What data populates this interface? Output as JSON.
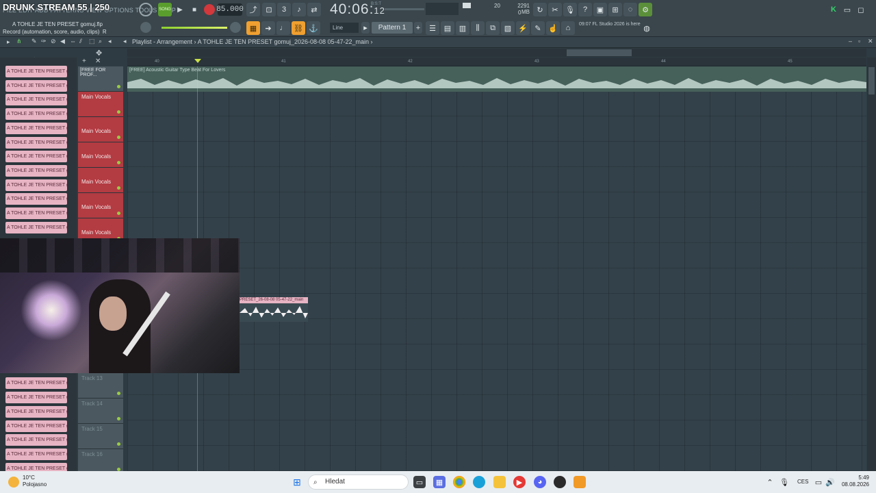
{
  "overlay": {
    "stream_title": "DRUNK STREAM 55 | 250",
    "menu_text": "FILE EDIT ADD PATTERNS VIEW OPTIONS TOOLS HELP"
  },
  "hint": {
    "file": "A TOHLE JE TEN PRESET gomuj.flp",
    "desc": "Record (automation, score, audio, clips)",
    "desc_suffix": "R"
  },
  "transport": {
    "song_label": "SONG",
    "tempo": "85.000",
    "time_main": "40:06",
    "time_sub": "12",
    "time_unit": "B:S:T",
    "mem_mb": "2291 MB",
    "mem_cpu": "20",
    "mem_poly": "0"
  },
  "toolbar": {
    "snap": "Line",
    "pattern": "Pattern 1",
    "pattern_add": "+",
    "news_time": "09:07",
    "news_text": "FL Studio 2026 is here"
  },
  "playlist": {
    "breadcrumb_1": "Playlist - Arrangement",
    "breadcrumb_2": "A TOHLE JE TEN PRESET gomuj_2026-08-08 05-47-22_main",
    "ruler": [
      "40",
      "41",
      "42",
      "43",
      "44",
      "45"
    ],
    "audio_track": {
      "header": "[FREE FOR PROF...",
      "clip_title": "[FREE] Acoustic Guitar Type Beat For Lovers"
    },
    "vocal_tracks": [
      "Main Vocals",
      "Main Vocals",
      "Main Vocals",
      "Main Vocals",
      "Main Vocals",
      "Main Vocals"
    ],
    "empty_tracks": [
      "Track 13",
      "Track 14",
      "Track 15",
      "Track 16"
    ],
    "clip": {
      "title": "PRESET_26-08-08 05-47-22_main"
    }
  },
  "picker": {
    "item_label": "A TOHLE JE TEN PRESET g"
  },
  "taskbar": {
    "weather_temp": "10°C",
    "weather_desc": "Polojasno",
    "search": "Hledat",
    "lang": "CES",
    "time": "5:49",
    "date": "08.08.2026"
  },
  "colors": {
    "accent": "#f0a030",
    "vocal_track": "#b33b42",
    "clip_pink": "#e7b4c4",
    "audio_track": "#46605a"
  }
}
